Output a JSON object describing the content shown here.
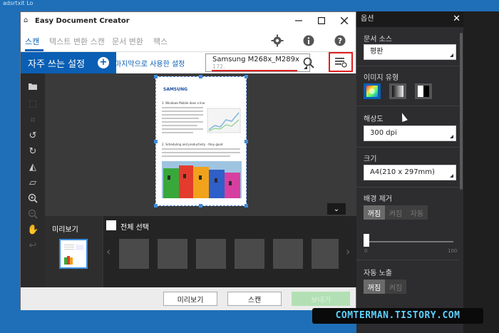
{
  "desktop": {
    "corner_label": "adsrtxit Lo"
  },
  "window": {
    "title": "Easy Document Creator",
    "controls": [
      "minimize-icon",
      "maximize-icon",
      "close-icon"
    ]
  },
  "tabs": [
    {
      "label": "스캔",
      "active": true
    },
    {
      "label": "텍스트 변환 스캔",
      "active": false
    },
    {
      "label": "문서 변환",
      "active": false
    },
    {
      "label": "팩스",
      "active": false
    }
  ],
  "toolbar_icons": [
    "gear-icon",
    "info-icon",
    "help-icon"
  ],
  "presets": {
    "frequent_label": "자주 쓰는 설정",
    "recent_label": "마지막으로 사용한 설정"
  },
  "device": {
    "name": "Samsung M268x_M289x",
    "ip": "172.",
    "search_icon": "search-icon",
    "options_icon": "options-list-icon"
  },
  "side_tools": [
    "open-icon",
    "crop-select-icon",
    "crop-icon",
    "rotate-left-icon",
    "rotate-right-icon",
    "flip-icon",
    "skew-icon",
    "zoom-in-icon",
    "zoom-out-icon",
    "pan-icon",
    "undo-icon"
  ],
  "preview": {
    "page_title": "SAMSUNG",
    "heading1": "1. Windows Mobile does a line",
    "heading2": "2. Scheduling and productivity - they good"
  },
  "thumbnails": {
    "title": "미리보기",
    "select_all": "전체 선택"
  },
  "buttons": {
    "preview": "미리보기",
    "scan": "스캔",
    "send": "보내기"
  },
  "options": {
    "title": "옵션",
    "doc_source_label": "문서 소스",
    "doc_source_value": "평판",
    "image_type_label": "이미지 유형",
    "resolution_label": "해상도",
    "resolution_value": "300 dpi",
    "size_label": "크기",
    "size_value": "A4(210 x 297mm)",
    "bg_remove_label": "배경 제거",
    "bg_remove_options": [
      "꺼짐",
      "켜짐",
      "자동"
    ],
    "bg_slider": {
      "min": "0",
      "max": "100",
      "value": 0
    },
    "auto_exposure_label": "자동 노출",
    "auto_exposure_options": [
      "꺼짐",
      "켜짐"
    ]
  },
  "watermark": "COMTERMAN.TISTORY.COM"
}
